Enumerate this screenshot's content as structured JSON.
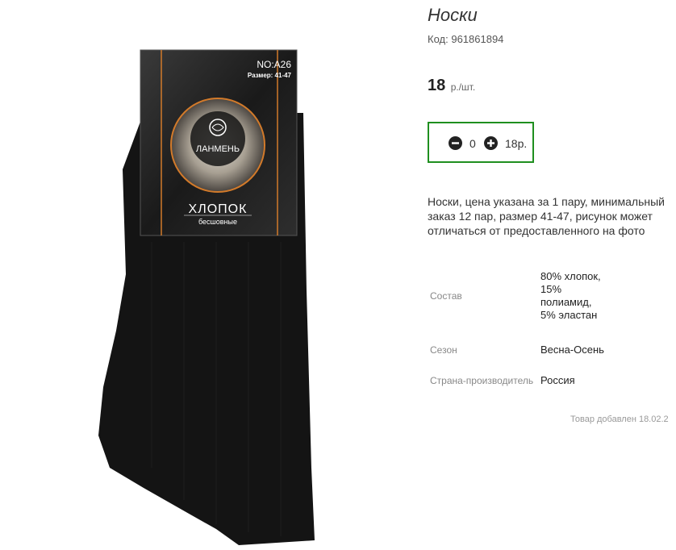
{
  "product": {
    "title": "Носки",
    "code_label": "Код:",
    "code": "961861894",
    "price_value": "18",
    "price_unit": "р./шт.",
    "quantity": "0",
    "total": "18р.",
    "description": "Носки, цена указана за 1 пару, минимальный заказ 12 пар, размер 41-47, рисунок может отличаться от предоставленного на фото",
    "added": "Товар добавлен 18.02.2"
  },
  "specs": {
    "composition_label": "Состав",
    "composition_value": "80% хлопок, 15% полиамид, 5% эластан",
    "season_label": "Сезон",
    "season_value": "Весна-Осень",
    "country_label": "Страна-производитель",
    "country_value": "Россия"
  },
  "package": {
    "model": "NO:A26",
    "size": "Размер: 41-47",
    "brand": "ЛАНМЕНЬ",
    "material": "ХЛОПОК",
    "seamless": "бесшовные"
  },
  "colors": {
    "accent_border": "#1f8f1f",
    "sock": "#141414"
  },
  "icons": {
    "minus": "minus-circle-icon",
    "plus": "plus-circle-icon"
  }
}
